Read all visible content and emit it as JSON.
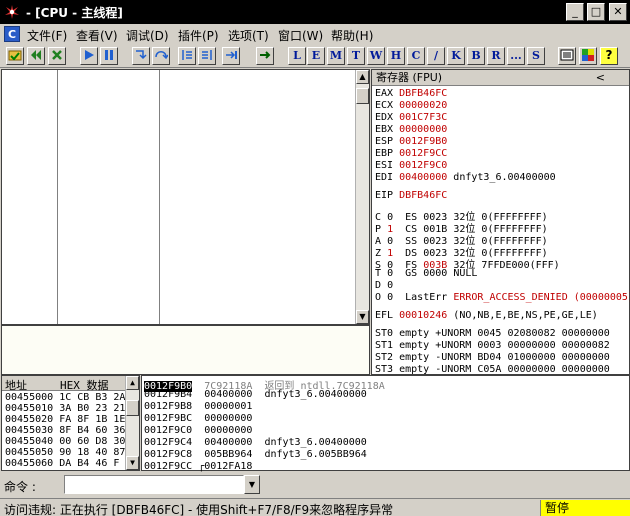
{
  "window": {
    "title": "- [CPU - 主线程]",
    "minimize": "_",
    "maximize": "□",
    "close": "✕"
  },
  "menu": {
    "icon_letter": "C",
    "items": [
      "文件(F)",
      "查看(V)",
      "调试(D)",
      "插件(P)",
      "选项(T)",
      "窗口(W)",
      "帮助(H)"
    ]
  },
  "toolbar": {
    "letters": [
      "L",
      "E",
      "M",
      "T",
      "W",
      "H",
      "C",
      "/",
      "K",
      "B",
      "R",
      "...",
      "S"
    ]
  },
  "registers": {
    "header": "寄存器 (FPU)",
    "chevron": "<",
    "gp": [
      {
        "name": "EAX",
        "value": "DBFB46FC",
        "comment": ""
      },
      {
        "name": "ECX",
        "value": "00000020",
        "comment": ""
      },
      {
        "name": "EDX",
        "value": "001C7F3C",
        "comment": ""
      },
      {
        "name": "EBX",
        "value": "00000000",
        "comment": ""
      },
      {
        "name": "ESP",
        "value": "0012F9B0",
        "comment": ""
      },
      {
        "name": "EBP",
        "value": "0012F9CC",
        "comment": ""
      },
      {
        "name": "ESI",
        "value": "0012F9C0",
        "comment": ""
      },
      {
        "name": "EDI",
        "value": "00400000",
        "comment": "dnfyt3_6.00400000"
      }
    ],
    "eip": {
      "name": "EIP",
      "value": "DBFB46FC"
    },
    "flags": [
      {
        "flag": "C",
        "val": "0",
        "seg": "ES",
        "sel": "0023",
        "bits": "32位",
        "info": "0(FFFFFFFF)"
      },
      {
        "flag": "P",
        "val": "1",
        "seg": "CS",
        "sel": "001B",
        "bits": "32位",
        "info": "0(FFFFFFFF)"
      },
      {
        "flag": "A",
        "val": "0",
        "seg": "SS",
        "sel": "0023",
        "bits": "32位",
        "info": "0(FFFFFFFF)"
      },
      {
        "flag": "Z",
        "val": "1",
        "seg": "DS",
        "sel": "0023",
        "bits": "32位",
        "info": "0(FFFFFFFF)"
      },
      {
        "flag": "S",
        "val": "0",
        "seg": "FS",
        "sel": "003B",
        "bits": "32位",
        "info": "7FFDE000(FFF)"
      },
      {
        "flag": "T",
        "val": "0",
        "seg": "GS",
        "sel": "0000",
        "bits": "",
        "info": "NULL"
      },
      {
        "flag": "D",
        "val": "0",
        "seg": "",
        "sel": "",
        "bits": "",
        "info": ""
      }
    ],
    "lasterr": {
      "flag": "O",
      "val": "0",
      "label": "LastErr",
      "value": "ERROR_ACCESS_DENIED (00000005)"
    },
    "efl": {
      "name": "EFL",
      "value": "00010246",
      "info": "(NO,NB,E,BE,NS,PE,GE,LE)"
    },
    "fpu": [
      "ST0 empty +UNORM 0045 02080082 00000000",
      "ST1 empty +UNORM 0003 00000000 00000082",
      "ST2 empty -UNORM BD04 01000000 00000000",
      "ST3 empty -UNORM C05A 00000000 00000000"
    ]
  },
  "dump": {
    "col_address": "地址",
    "col_hex": "HEX 数据",
    "rows": [
      {
        "addr": "00455000",
        "hex": "1C CB B3 2A"
      },
      {
        "addr": "00455010",
        "hex": "3A B0 23 21"
      },
      {
        "addr": "00455020",
        "hex": "FA 8F 1B 1E"
      },
      {
        "addr": "00455030",
        "hex": "8F B4 60 36"
      },
      {
        "addr": "00455040",
        "hex": "00 60 D8 30"
      },
      {
        "addr": "00455050",
        "hex": "90 18 40 87"
      },
      {
        "addr": "00455060",
        "hex": "DA B4 46 F"
      }
    ]
  },
  "stack": {
    "rows": [
      {
        "addr": "0012F9B0",
        "value": "7C92118A",
        "comment": "返回到 ntdll.7C92118A",
        "selected": true
      },
      {
        "addr": "0012F9B4",
        "value": "00400000",
        "comment": "dnfyt3_6.00400000"
      },
      {
        "addr": "0012F9B8",
        "value": "00000001",
        "comment": ""
      },
      {
        "addr": "0012F9BC",
        "value": "00000000",
        "comment": ""
      },
      {
        "addr": "0012F9C0",
        "value": "00000000",
        "comment": ""
      },
      {
        "addr": "0012F9C4",
        "value": "00400000",
        "comment": "dnfyt3_6.00400000"
      },
      {
        "addr": "0012F9C8",
        "value": "005BB964",
        "comment": "dnfyt3_6.005BB964"
      },
      {
        "addr": "0012F9CC",
        "value": "0012FA18",
        "comment": ""
      }
    ]
  },
  "command": {
    "label": "命令 :",
    "value": ""
  },
  "status": {
    "message": "访问违规: 正在执行 [DBFB46FC] - 使用Shift+F7/F8/F9来忽略程序异常",
    "state": "暂停"
  }
}
